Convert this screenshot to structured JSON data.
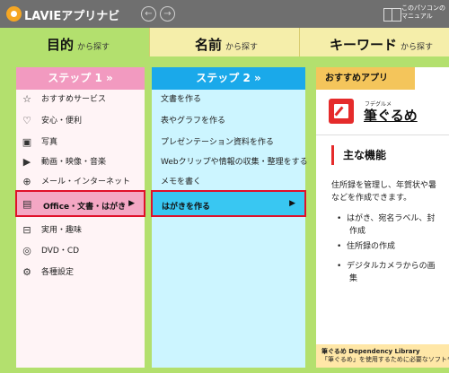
{
  "titlebar": {
    "app_title": "LAVIEアプリナビ",
    "back": "←",
    "forward": "→",
    "manual_label_line1": "このパソコンの",
    "manual_label_line2": "マニュアル"
  },
  "tabs": [
    {
      "main": "目的",
      "sub": "から探す"
    },
    {
      "main": "名前",
      "sub": "から探す"
    },
    {
      "main": "キーワード",
      "sub": "から探す"
    }
  ],
  "step1": {
    "header": "ステップ 1 »",
    "items": [
      {
        "label": "おすすめサービス",
        "icon": "star-icon"
      },
      {
        "label": "安心・便利",
        "icon": "heart-icon"
      },
      {
        "label": "写真",
        "icon": "camera-icon"
      },
      {
        "label": "動画・映像・音楽",
        "icon": "video-icon"
      },
      {
        "label": "メール・インターネット",
        "icon": "globe-icon"
      },
      {
        "label": "Office・文書・はがき",
        "icon": "document-icon"
      },
      {
        "label": "実用・趣味",
        "icon": "toolbox-icon"
      },
      {
        "label": "DVD・CD",
        "icon": "disc-icon"
      },
      {
        "label": "各種設定",
        "icon": "gear-icon"
      }
    ],
    "selected_arrow": "▶"
  },
  "step2": {
    "header": "ステップ 2 »",
    "items": [
      {
        "label": "文書を作る"
      },
      {
        "label": "表やグラフを作る"
      },
      {
        "label": "プレゼンテーション資料を作る"
      },
      {
        "label": "Webクリップや情報の収集・整理をする"
      },
      {
        "label": "メモを書く"
      },
      {
        "label": "はがきを作る"
      }
    ],
    "selected_arrow": "▶"
  },
  "recommended": {
    "header": "おすすめアプリ",
    "furigana": "フデグルメ",
    "app_name": "筆ぐるめ",
    "feature_title": "主な機能",
    "description_line1": "住所録を管理し、年賀状や暑",
    "description_line2": "などを作成できます。",
    "bullets": [
      {
        "line1": "はがき、宛名ラベル、封",
        "line2": "作成"
      },
      {
        "line1": "住所録の作成",
        "line2": ""
      },
      {
        "line1": "デジタルカメラからの画",
        "line2": "集"
      }
    ],
    "footer_line1": "筆ぐるめ Dependency Library",
    "footer_line2": "「筆ぐるめ」を使用するために必要なソフトウェアです。"
  },
  "colors": {
    "background": "#b3e06e",
    "step1_header": "#f29ac0",
    "step2_header": "#1aa9ea",
    "selection_border": "#e0102a",
    "recommended_header": "#f4c55b"
  }
}
